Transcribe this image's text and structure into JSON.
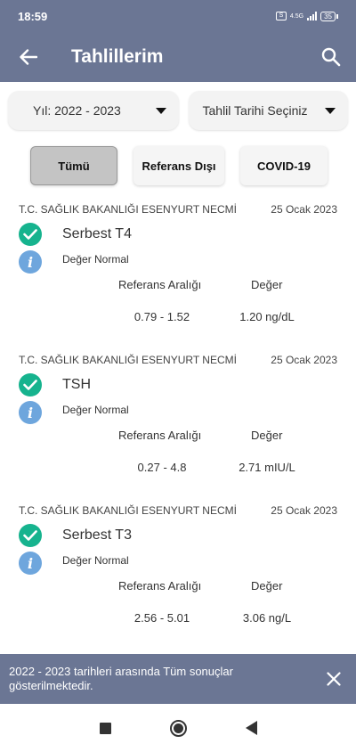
{
  "status_bar": {
    "time": "18:59",
    "sim_badge": "S",
    "network_type": "4.5G",
    "battery_level": "35"
  },
  "app_bar": {
    "title": "Tahlillerim",
    "back_icon": "arrow-left-icon",
    "search_icon": "search-icon"
  },
  "filters": {
    "year_label": "Yıl: 2022 - 2023",
    "date_label": "Tahlil Tarihi Seçiniz"
  },
  "tabs": [
    {
      "label": "Tümü",
      "active": true
    },
    {
      "label": "Referans Dışı",
      "active": false
    },
    {
      "label": "COVID-19",
      "active": false
    }
  ],
  "column_headers": {
    "reference": "Referans Aralığı",
    "value": "Değer"
  },
  "results": [
    {
      "hospital": "T.C. SAĞLIK BAKANLIĞI ESENYURT NECMİ",
      "date": "25 Ocak 2023",
      "name": "Serbest T4",
      "status": "Değer Normal",
      "reference": "0.79 - 1.52",
      "value": "1.20 ng/dL"
    },
    {
      "hospital": "T.C. SAĞLIK BAKANLIĞI ESENYURT NECMİ",
      "date": "25 Ocak 2023",
      "name": "TSH",
      "status": "Değer Normal",
      "reference": "0.27 - 4.8",
      "value": "2.71 mIU/L"
    },
    {
      "hospital": "T.C. SAĞLIK BAKANLIĞI ESENYURT NECMİ",
      "date": "25 Ocak 2023",
      "name": "Serbest T3",
      "status": "Değer Normal",
      "reference": "2.56 - 5.01",
      "value": "3.06 ng/L"
    }
  ],
  "snackbar": {
    "message": "2022 - 2023 tarihleri arasında Tüm sonuçlar gösterilmektedir."
  },
  "colors": {
    "header": "#6b7694",
    "check": "#16b38e",
    "info": "#6ea6dd"
  },
  "info_glyph": "i"
}
